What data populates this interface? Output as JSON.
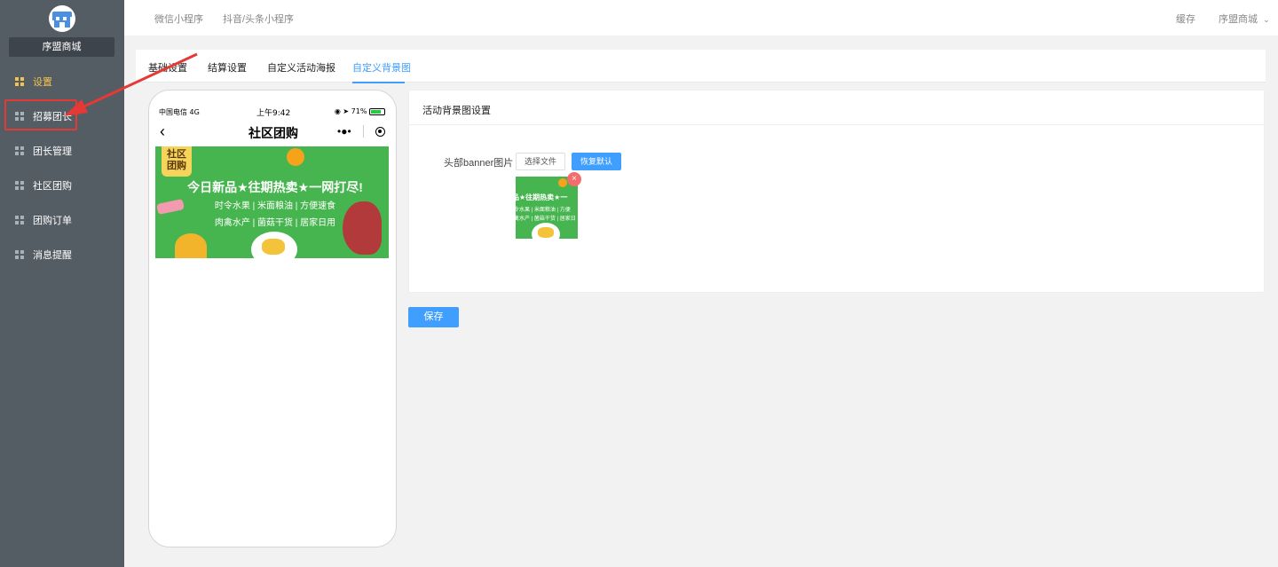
{
  "sidebar": {
    "shop_name": "序盟商城",
    "items": [
      {
        "label": "设置",
        "active": true
      },
      {
        "label": "招募团长",
        "active": false
      },
      {
        "label": "团长管理",
        "active": false
      },
      {
        "label": "社区团购",
        "active": false
      },
      {
        "label": "团购订单",
        "active": false
      },
      {
        "label": "消息提醒",
        "active": false
      }
    ]
  },
  "topbar": {
    "nav": [
      "微信小程序",
      "抖音/头条小程序"
    ],
    "cache": "缓存",
    "user_menu": "序盟商城"
  },
  "tabs": [
    {
      "label": "基础设置",
      "active": false
    },
    {
      "label": "结算设置",
      "active": false
    },
    {
      "label": "自定义活动海报",
      "active": false
    },
    {
      "label": "自定义背景图",
      "active": true
    }
  ],
  "phone": {
    "status_left": "中国电信  4G",
    "status_time": "上午9:42",
    "status_battery": "71%",
    "back_icon": "chevron-left-icon",
    "title": "社区团购",
    "banner": {
      "badge": "社区\n团购",
      "headline": "今日新品★往期热卖★一网打尽!",
      "line1": "时令水果 | 米面粮油 | 方便速食",
      "line2": "肉禽水产 | 菌菇干货 | 居家日用"
    }
  },
  "card": {
    "title": "活动背景图设置",
    "field_label": "头部banner图片",
    "choose_file": "选择文件",
    "reset_default": "恢复默认",
    "thumb_line1": "品★往期热卖★一",
    "thumb_line2": "令水果 | 米面粮油 | 方便",
    "thumb_line3": "禽水产 | 菌菇干货 | 居家日"
  },
  "save_label": "保存",
  "colors": {
    "sidebar_bg": "#545c64",
    "accent_blue": "#409eff",
    "active_menu": "#f5c34b",
    "annotation_red": "#e53935"
  }
}
